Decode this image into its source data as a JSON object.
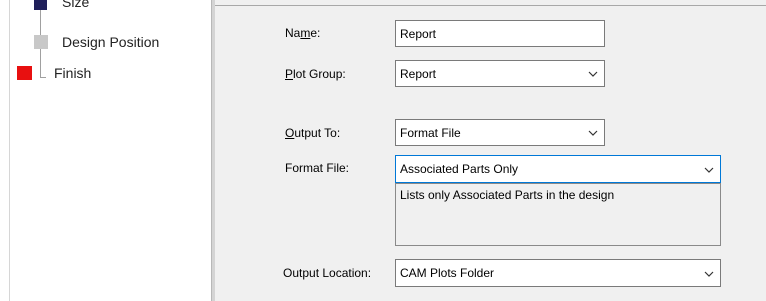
{
  "tree": {
    "items": [
      {
        "label": "Size",
        "color": "#1f1f5a"
      },
      {
        "label": "Design Position",
        "color": "#c8c8c8"
      },
      {
        "label": "Finish",
        "color": "#e81010"
      }
    ]
  },
  "form": {
    "name_label_pre": "Na",
    "name_label_ul": "m",
    "name_label_post": "e:",
    "name_value": "Report",
    "plot_group_label_ul": "P",
    "plot_group_label_post": "lot Group:",
    "plot_group_value": "Report",
    "output_to_label_ul": "O",
    "output_to_label_post": "utput To:",
    "output_to_value": "Format File",
    "format_file_label": "Format File:",
    "format_file_value": "Associated Parts Only",
    "format_file_description": "Lists only Associated Parts in the design",
    "output_location_label": "Output Location:",
    "output_location_value": "CAM Plots Folder"
  },
  "colors": {
    "accent": "#0078d7"
  }
}
